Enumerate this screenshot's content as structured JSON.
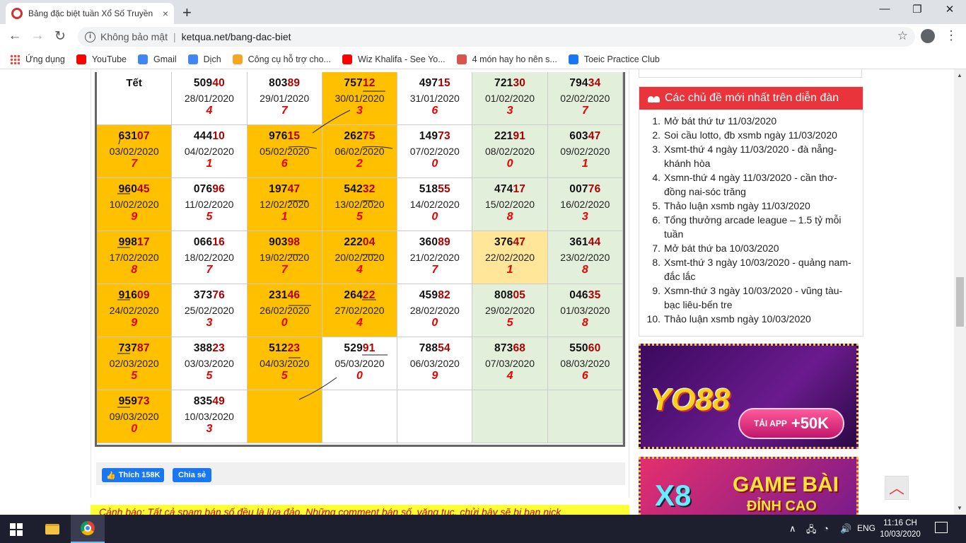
{
  "browser": {
    "tab_title": "Bảng đặc biệt tuần Xổ Số Truyền",
    "tab_close": "×",
    "new_tab": "+",
    "win_min": "—",
    "win_max": "❐",
    "win_close": "✕",
    "back": "←",
    "forward": "→",
    "reload": "↻",
    "security_label": "Không bảo mật",
    "separator": "|",
    "url": "ketqua.net/bang-dac-biet",
    "star": "☆",
    "menu": "⋮"
  },
  "bookmarks": [
    {
      "label": "Ứng dụng",
      "icon": "apps-icon",
      "color": "#e8453c"
    },
    {
      "label": "YouTube",
      "icon": "youtube-icon",
      "color": "#ff0000"
    },
    {
      "label": "Gmail",
      "icon": "google-icon",
      "color": "#4285f4"
    },
    {
      "label": "Dịch",
      "icon": "translate-icon",
      "color": "#4285f4"
    },
    {
      "label": "Công cụ hỗ trợ cho...",
      "icon": "xs-icon",
      "color": "#f5a623"
    },
    {
      "label": "Wiz Khalifa - See Yo...",
      "icon": "youtube-icon",
      "color": "#ff0000"
    },
    {
      "label": "4 món hay ho nên s...",
      "icon": "site-icon",
      "color": "#d9534f"
    },
    {
      "label": "Toeic Practice Club",
      "icon": "facebook-icon",
      "color": "#1877f2"
    }
  ],
  "table": {
    "rows": [
      [
        {
          "label": "Tết",
          "bg": "w"
        },
        {
          "head": "509",
          "tail": "40",
          "date": "28/01/2020",
          "total": "4",
          "bg": "w"
        },
        {
          "head": "803",
          "tail": "89",
          "date": "29/01/2020",
          "total": "7",
          "bg": "w"
        },
        {
          "head": "757",
          "tail": "12",
          "date": "30/01/2020",
          "total": "3",
          "bg": "o"
        },
        {
          "head": "497",
          "tail": "15",
          "date": "31/01/2020",
          "total": "6",
          "bg": "w"
        },
        {
          "head": "721",
          "tail": "30",
          "date": "01/02/2020",
          "total": "3",
          "bg": "g"
        },
        {
          "head": "794",
          "tail": "34",
          "date": "02/02/2020",
          "total": "7",
          "bg": "g"
        }
      ],
      [
        {
          "head": "631",
          "tail": "07",
          "date": "03/02/2020",
          "total": "7",
          "bg": "o"
        },
        {
          "head": "444",
          "tail": "10",
          "date": "04/02/2020",
          "total": "1",
          "bg": "w"
        },
        {
          "head": "976",
          "tail": "15",
          "date": "05/02/2020",
          "total": "6",
          "bg": "o"
        },
        {
          "head": "262",
          "tail": "75",
          "date": "06/02/2020",
          "total": "2",
          "bg": "o"
        },
        {
          "head": "149",
          "tail": "73",
          "date": "07/02/2020",
          "total": "0",
          "bg": "w"
        },
        {
          "head": "221",
          "tail": "91",
          "date": "08/02/2020",
          "total": "0",
          "bg": "g"
        },
        {
          "head": "603",
          "tail": "47",
          "date": "09/02/2020",
          "total": "1",
          "bg": "g"
        }
      ],
      [
        {
          "head": "960",
          "tail": "45",
          "date": "10/02/2020",
          "total": "9",
          "bg": "o"
        },
        {
          "head": "076",
          "tail": "96",
          "date": "11/02/2020",
          "total": "5",
          "bg": "w"
        },
        {
          "head": "197",
          "tail": "47",
          "date": "12/02/2020",
          "total": "1",
          "bg": "o"
        },
        {
          "head": "542",
          "tail": "32",
          "date": "13/02/2020",
          "total": "5",
          "bg": "o"
        },
        {
          "head": "518",
          "tail": "55",
          "date": "14/02/2020",
          "total": "0",
          "bg": "w"
        },
        {
          "head": "474",
          "tail": "17",
          "date": "15/02/2020",
          "total": "8",
          "bg": "g"
        },
        {
          "head": "007",
          "tail": "76",
          "date": "16/02/2020",
          "total": "3",
          "bg": "g"
        }
      ],
      [
        {
          "head": "998",
          "tail": "17",
          "date": "17/02/2020",
          "total": "8",
          "bg": "o"
        },
        {
          "head": "066",
          "tail": "16",
          "date": "18/02/2020",
          "total": "7",
          "bg": "w"
        },
        {
          "head": "903",
          "tail": "98",
          "date": "19/02/2020",
          "total": "7",
          "bg": "o"
        },
        {
          "head": "222",
          "tail": "04",
          "date": "20/02/2020",
          "total": "4",
          "bg": "o"
        },
        {
          "head": "360",
          "tail": "89",
          "date": "21/02/2020",
          "total": "7",
          "bg": "w"
        },
        {
          "head": "376",
          "tail": "47",
          "date": "22/02/2020",
          "total": "1",
          "bg": "y"
        },
        {
          "head": "361",
          "tail": "44",
          "date": "23/02/2020",
          "total": "8",
          "bg": "g"
        }
      ],
      [
        {
          "head": "916",
          "tail": "09",
          "date": "24/02/2020",
          "total": "9",
          "bg": "o"
        },
        {
          "head": "373",
          "tail": "76",
          "date": "25/02/2020",
          "total": "3",
          "bg": "w"
        },
        {
          "head": "231",
          "tail": "46",
          "date": "26/02/2020",
          "total": "0",
          "bg": "o"
        },
        {
          "head": "264",
          "tail": "22",
          "date": "27/02/2020",
          "total": "4",
          "bg": "o"
        },
        {
          "head": "459",
          "tail": "82",
          "date": "28/02/2020",
          "total": "0",
          "bg": "w"
        },
        {
          "head": "808",
          "tail": "05",
          "date": "29/02/2020",
          "total": "5",
          "bg": "g"
        },
        {
          "head": "046",
          "tail": "35",
          "date": "01/03/2020",
          "total": "8",
          "bg": "g"
        }
      ],
      [
        {
          "head": "737",
          "tail": "87",
          "date": "02/03/2020",
          "total": "5",
          "bg": "o"
        },
        {
          "head": "388",
          "tail": "23",
          "date": "03/03/2020",
          "total": "5",
          "bg": "w"
        },
        {
          "head": "512",
          "tail": "23",
          "date": "04/03/2020",
          "total": "5",
          "bg": "o"
        },
        {
          "head": "529",
          "tail": "91",
          "date": "05/03/2020",
          "total": "0",
          "bg": "w"
        },
        {
          "head": "788",
          "tail": "54",
          "date": "06/03/2020",
          "total": "9",
          "bg": "w"
        },
        {
          "head": "873",
          "tail": "68",
          "date": "07/03/2020",
          "total": "4",
          "bg": "g"
        },
        {
          "head": "550",
          "tail": "60",
          "date": "08/03/2020",
          "total": "6",
          "bg": "g"
        }
      ],
      [
        {
          "head": "959",
          "tail": "73",
          "date": "09/03/2020",
          "total": "0",
          "bg": "o"
        },
        {
          "head": "835",
          "tail": "49",
          "date": "10/03/2020",
          "total": "3",
          "bg": "w"
        },
        {
          "bg": "o"
        },
        {
          "bg": "w"
        },
        {
          "bg": "w"
        },
        {
          "bg": "g"
        },
        {
          "bg": "g"
        }
      ]
    ]
  },
  "share": {
    "like_label": "Thích 158K",
    "share_label": "Chia sẻ"
  },
  "warning": "Cảnh báo: Tất cả spam bán số đều là lừa đảo. Những comment bán số, văng tục, chửi bậy sẽ bị ban nick",
  "forum": {
    "title": "Các chủ đề mới nhất trên diễn đàn",
    "items": [
      "Mở bát thứ tư 11/03/2020",
      "Soi cầu lotto, đb xsmb ngày 11/03/2020",
      "Xsmt-thứ 4 ngày 11/03/2020 - đà nẵng-khánh hòa",
      "Xsmn-thứ 4 ngày 11/03/2020 - cần thơ-đồng nai-sóc trăng",
      "Thảo luận xsmb ngày 11/03/2020",
      "Tổng thưởng arcade league – 1.5 tỷ mỗi tuần",
      "Mở bát thứ ba 10/03/2020",
      "Xsmt-thứ 3 ngày 10/03/2020 - quảng nam-đắc lắc",
      "Xsmn-thứ 3 ngày 10/03/2020 - vũng tàu-bạc liêu-bến tre",
      "Thảo luận xsmb ngày 10/03/2020"
    ]
  },
  "ads": {
    "yo88_logo": "YO88",
    "yo88_cta_small": "TẢI APP",
    "yo88_cta": "+50K",
    "x8_logo": "X8",
    "x8_line1": "GAME BÀI",
    "x8_line2": "ĐỈNH CAO"
  },
  "to_top": "︿",
  "taskbar": {
    "lang": "ENG",
    "time": "11:16 CH",
    "date": "10/03/2020",
    "tray_arrow": "∧"
  }
}
